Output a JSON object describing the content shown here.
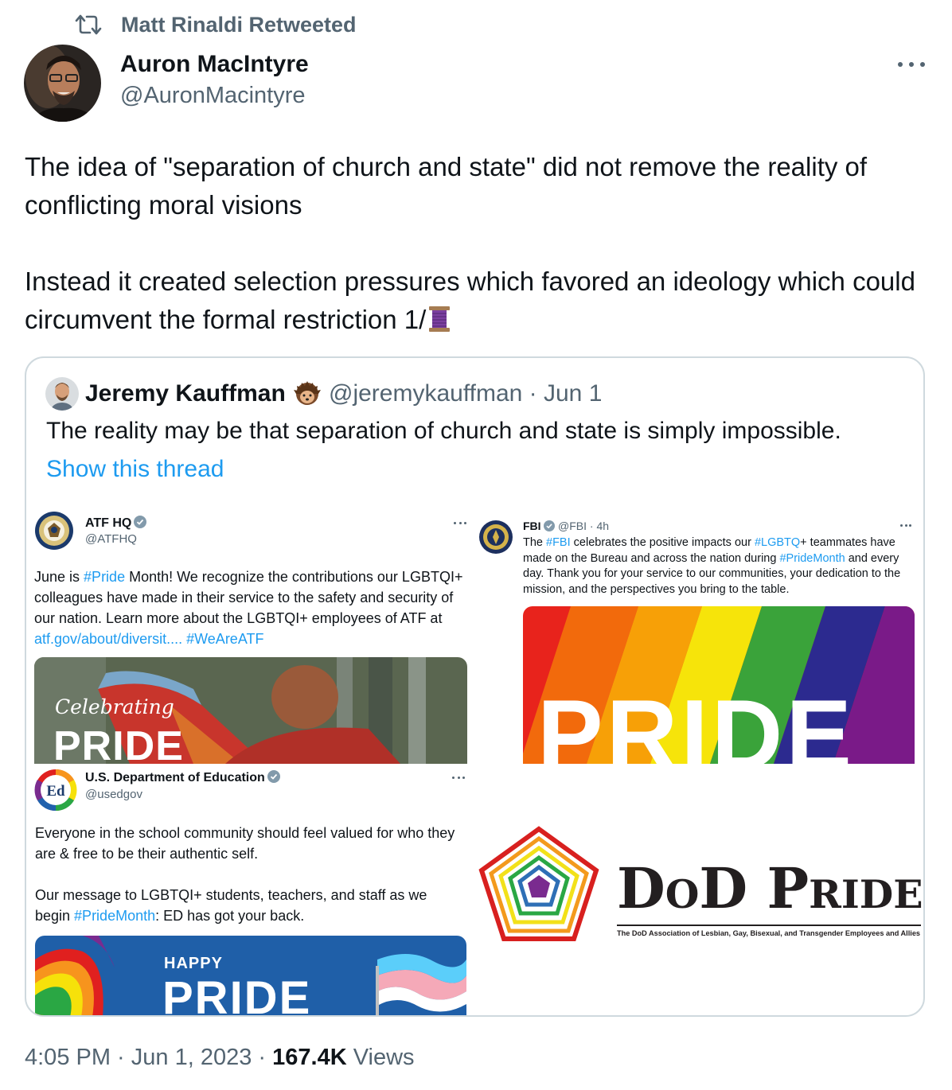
{
  "retweet": {
    "label": "Matt Rinaldi Retweeted"
  },
  "author": {
    "name": "Auron MacIntyre",
    "handle": "@AuronMacintyre"
  },
  "tweet": {
    "paragraph1": "The idea of \"separation of church and state\" did not remove the reality of conflicting moral visions",
    "paragraph2": "Instead it created selection pressures which favored an ideology which could circumvent the formal restriction 1/"
  },
  "quote": {
    "name": "Jeremy Kauffman",
    "meta": "@jeremykauffman · Jun 1",
    "text": "The reality may be that separation of church and state is simply impossible.",
    "show_thread": "Show this thread"
  },
  "atf": {
    "name": "ATF HQ",
    "handle": "@ATFHQ",
    "text_pre": "June is ",
    "hashtag1": "#Pride",
    "text_mid": " Month! We recognize the contributions our LGBTQI+ colleagues have made in their service to the safety and security of our nation. Learn more about the LGBTQI+ employees of ATF at ",
    "link": "atf.gov/about/diversit....",
    "hashtag2": "#WeAreATF",
    "image_script": "Celebrating",
    "image_title": "PRIDE"
  },
  "fbi": {
    "name": "FBI",
    "meta": "@FBI · 4h",
    "t1": "The ",
    "h1": "#FBI",
    "t2": " celebrates the positive impacts our ",
    "h2": "#LGBTQ",
    "t3": "+ teammates have made on the Bureau and across the nation during ",
    "h3": "#PrideMonth",
    "t4": " and every day. Thank you for your service to our communities, your dedication to the mission, and the perspectives you bring to the table.",
    "image_title": "PRIDE"
  },
  "ed": {
    "name": "U.S. Department of Education",
    "handle": "@usedgov",
    "p1": "Everyone in the school community should feel valued for who they are & free to be their authentic self.",
    "p2_pre": "Our message to LGBTQI+ students, teachers, and staff as we begin ",
    "p2_hashtag": "#PrideMonth",
    "p2_post": ": ED has got your back.",
    "image_small": "HAPPY",
    "image_title": "PRIDE"
  },
  "dod": {
    "title": "DoD Pride",
    "subtitle": "The DoD Association of Lesbian, Gay, Bisexual, and Transgender Employees and Allies"
  },
  "footer": {
    "time": "4:05 PM · Jun 1, 2023 · ",
    "views_count": "167.4K",
    "views_label": " Views"
  },
  "colors": {
    "link": "#1d9bf0",
    "secondary_text": "#536471",
    "primary_text": "#0f1419",
    "border": "#cfd9de"
  }
}
